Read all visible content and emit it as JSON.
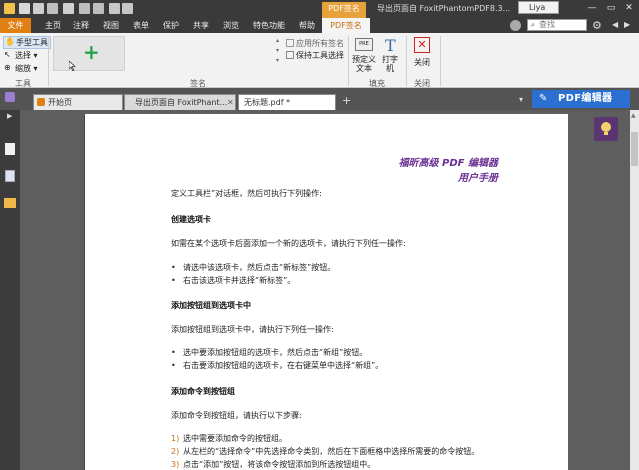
{
  "titlebar": {
    "context_tab": "PDF签名",
    "title": "导出页面自 FoxitPhantomPDF8.3...",
    "user": "Liya",
    "minimize": "—",
    "maximize": "▭",
    "close": "✕"
  },
  "menu": {
    "tabs": [
      "文件",
      "主页",
      "注释",
      "视图",
      "表单",
      "保护",
      "共享",
      "浏览",
      "特色功能",
      "帮助",
      "PDF签名"
    ],
    "search_placeholder": "查找"
  },
  "ribbon": {
    "tools": {
      "hand": "手型工具",
      "select": "选择",
      "zoom": "缩放",
      "label": "工具"
    },
    "signature_group_label": "签名",
    "apply_all": "应用所有签名",
    "keep_tool": "保持工具选择",
    "predefined_text": "预定义文本",
    "typewriter": "打字机",
    "fill_label": "填充",
    "close": "关闭",
    "close_label": "关闭"
  },
  "doc_tabs": [
    {
      "label": "开始页"
    },
    {
      "label": "导出页面自 FoxitPhant..."
    },
    {
      "label": "无标题.pdf *"
    }
  ],
  "editor_button": "PDF编辑器",
  "document": {
    "title_line1": "福昕高级 PDF 编辑器",
    "title_line2": "用户手册",
    "intro": "定义工具栏”对话框，然后可执行下列操作:",
    "section1": {
      "heading": "创建选项卡",
      "text": "如需在某个选项卡后面添加一个新的选项卡，请执行下列任一操作:",
      "bullets": [
        "请选中该选项卡，然后点击“新标签”按钮。",
        "右击该选项卡并选择“新标签”。"
      ]
    },
    "section2": {
      "heading": "添加按钮组到选项卡中",
      "text": "添加按钮组到选项卡中，请执行下列任一操作:",
      "bullets": [
        "选中要添加按钮组的选项卡，然后点击“新组”按钮。",
        "右击要添加按钮组的选项卡，在右键菜单中选择“新组”。"
      ]
    },
    "section3": {
      "heading": "添加命令到按钮组",
      "text": "添加命令到按钮组，请执行以下步骤:",
      "steps": [
        {
          "num": "1)",
          "text": "选中需要添加命令的按钮组。"
        },
        {
          "num": "2)",
          "text": "从左栏的“选择命令”中先选择命令类别，然后在下面框格中选择所需要的命令按钮。"
        },
        {
          "num": "3)",
          "text": "点击“添加”按钮，将该命令按钮添加到所选按钮组中。"
        }
      ]
    },
    "bullet_char": "•"
  },
  "colors": {
    "accent_orange": "#e07f12",
    "title_purple": "#6b3093",
    "editor_blue": "#2b6fd1",
    "add_green": "#25a24a"
  }
}
